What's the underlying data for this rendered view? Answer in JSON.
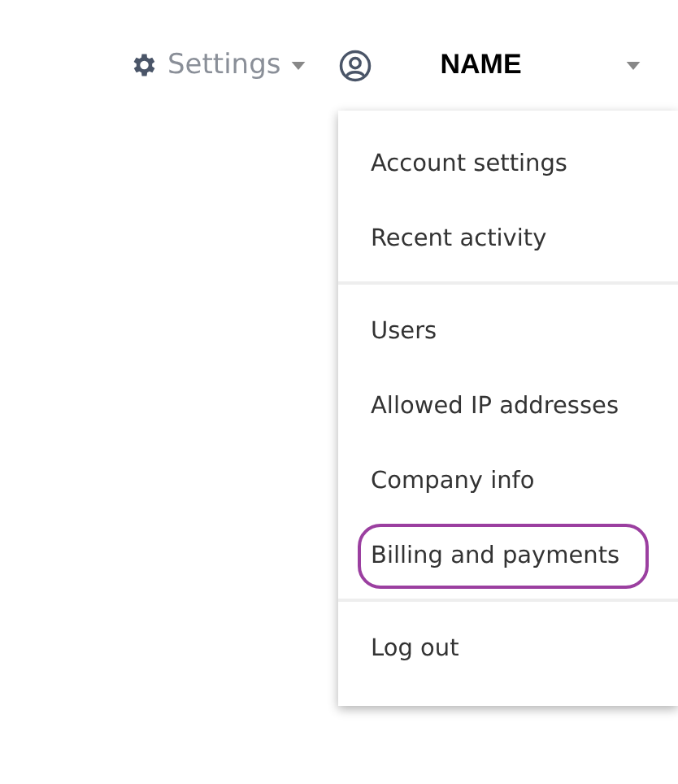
{
  "header": {
    "settings_label": "Settings",
    "user_name": "NAME"
  },
  "menu": {
    "groups": [
      {
        "items": [
          {
            "label": "Account settings",
            "highlighted": false
          },
          {
            "label": "Recent activity",
            "highlighted": false
          }
        ]
      },
      {
        "items": [
          {
            "label": "Users",
            "highlighted": false
          },
          {
            "label": "Allowed IP addresses",
            "highlighted": false
          },
          {
            "label": "Company info",
            "highlighted": false
          },
          {
            "label": "Billing and payments",
            "highlighted": true
          }
        ]
      },
      {
        "items": [
          {
            "label": "Log out",
            "highlighted": false
          }
        ]
      }
    ]
  }
}
